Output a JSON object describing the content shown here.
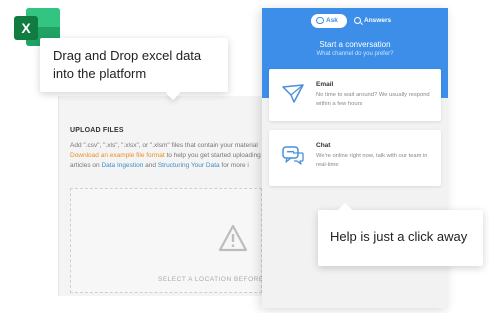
{
  "app": {
    "upload_heading": "UPLOAD FILES",
    "description_lines": [
      [
        "Add \".csv\", \".xls\", \".xlsx\", or \".xlsm\" files that contain your material",
        "",
        ""
      ],
      [
        "",
        "Download an example file format",
        " to help you get started uploading"
      ],
      [
        "articles on ",
        "Data Ingestion",
        " and "
      ]
    ],
    "description_link_structuring": "Structuring Your Data",
    "description_tail": " for more i",
    "dropzone_text": "SELECT A LOCATION BEFORE UP",
    "warning_icon": "warning-triangle-icon"
  },
  "excel": {
    "letter": "X",
    "icon": "excel-icon"
  },
  "callouts": {
    "drag_drop": [
      "Drag and Drop excel data",
      "into the platform"
    ],
    "help": "Help is just a click away"
  },
  "widget": {
    "tabs": {
      "ask": "Ask",
      "answers": "Answers"
    },
    "start_title": "Start a conversation",
    "start_subtitle": "What channel do you prefer?",
    "options": [
      {
        "title": "Email",
        "description": "No time to wait around? We usually respond within a few hours",
        "icon": "paper-plane-icon"
      },
      {
        "title": "Chat",
        "description": "We're online right now, talk with our team in real-time",
        "icon": "chat-bubbles-icon"
      }
    ]
  },
  "colors": {
    "widget_blue": "#3c8ee8",
    "excel_green": "#107c41",
    "link_orange": "#e8902a",
    "link_blue": "#3e8ec7"
  }
}
